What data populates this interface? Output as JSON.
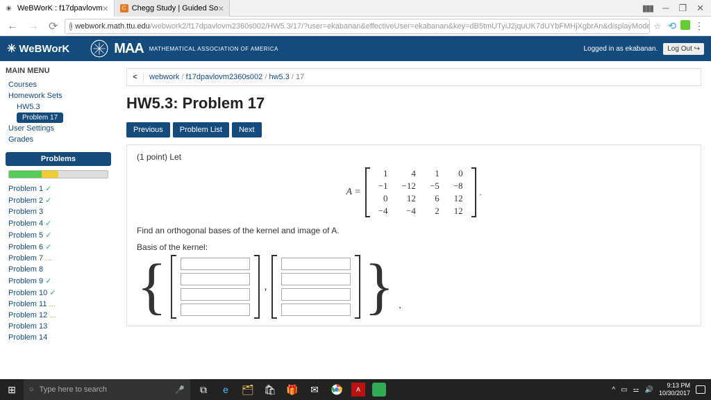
{
  "browser": {
    "tabs": [
      {
        "title": "WeBWorK : f17dpavlovm",
        "active": true
      },
      {
        "title": "Chegg Study | Guided So",
        "active": false
      }
    ],
    "url_host": "webwork.math.ttu.edu",
    "url_path": "/webwork2/f17dpavlovm2360s002/HW5.3/17/?user=ekabanan&effectiveUser=ekabanan&key=dB5tmUTyiJ2jquUK7dUYbFMHjXgbrAn&displayMode=MathJ..."
  },
  "header": {
    "brand": "WeBWorK",
    "maa": "MAA",
    "maa_sub": "MATHEMATICAL ASSOCIATION OF AMERICA",
    "logged": "Logged in as ekabanan.",
    "logout": "Log Out"
  },
  "sidebar": {
    "main_menu": "MAIN MENU",
    "courses": "Courses",
    "hwsets": "Homework Sets",
    "hw": "HW5.3",
    "current": "Problem 17",
    "user_settings": "User Settings",
    "grades": "Grades",
    "problems_hdr": "Problems",
    "progress": [
      {
        "color": "#5c5",
        "w": 33
      },
      {
        "color": "#ec3",
        "w": 17
      },
      {
        "color": "#ddd",
        "w": 50
      }
    ],
    "problems": [
      {
        "label": "Problem 1",
        "status": "check"
      },
      {
        "label": "Problem 2",
        "status": "check"
      },
      {
        "label": "Problem 3",
        "status": ""
      },
      {
        "label": "Problem 4",
        "status": "check"
      },
      {
        "label": "Problem 5",
        "status": "check"
      },
      {
        "label": "Problem 6",
        "status": "check"
      },
      {
        "label": "Problem 7",
        "status": "dots"
      },
      {
        "label": "Problem 8",
        "status": ""
      },
      {
        "label": "Problem 9",
        "status": "check"
      },
      {
        "label": "Problem 10",
        "status": "check"
      },
      {
        "label": "Problem 11",
        "status": "dots"
      },
      {
        "label": "Problem 12",
        "status": "dots"
      },
      {
        "label": "Problem 13",
        "status": ""
      },
      {
        "label": "Problem 14",
        "status": ""
      }
    ]
  },
  "breadcrumb": {
    "a": "webwork",
    "b": "f17dpavlovm2360s002",
    "c": "hw5.3",
    "d": "17"
  },
  "content": {
    "title": "HW5.3: Problem 17",
    "btn_prev": "Previous",
    "btn_list": "Problem List",
    "btn_next": "Next",
    "points": "(1 point) Let",
    "A_label": "A =",
    "matrix": [
      [
        "1",
        "4",
        "1",
        "0"
      ],
      [
        "−1",
        "−12",
        "−5",
        "−8"
      ],
      [
        "0",
        "12",
        "6",
        "12"
      ],
      [
        "−4",
        "−4",
        "2",
        "12"
      ]
    ],
    "instruction": "Find an orthogonal bases of the kernel and image of A.",
    "basis_label": "Basis of the kernel:",
    "comma": ",",
    "period_brace": "."
  },
  "taskbar": {
    "search_placeholder": "Type here to search",
    "time": "9:13 PM",
    "date": "10/30/2017"
  }
}
